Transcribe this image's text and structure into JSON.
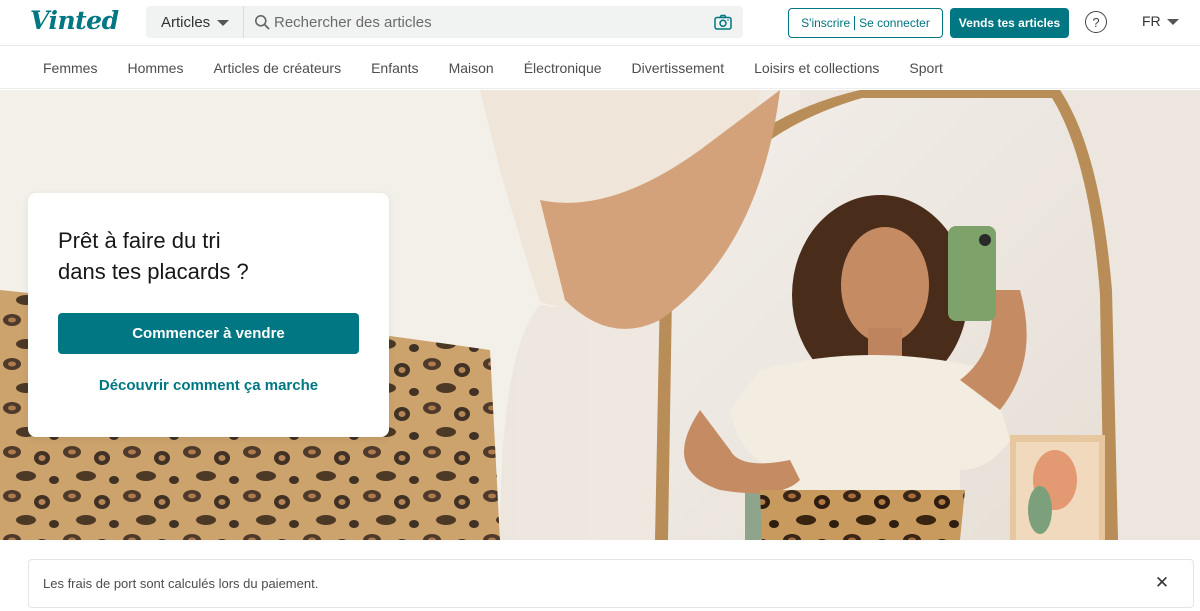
{
  "header": {
    "logo": "Vinted",
    "search": {
      "category_label": "Articles",
      "placeholder": "Rechercher des articles",
      "value": ""
    },
    "signup_label": "S'inscrire",
    "login_label": "Se connecter",
    "sell_label": "Vends tes articles",
    "help_symbol": "?",
    "language": "FR"
  },
  "catnav": {
    "items": [
      "Femmes",
      "Hommes",
      "Articles de créateurs",
      "Enfants",
      "Maison",
      "Électronique",
      "Divertissement",
      "Loisirs et collections",
      "Sport"
    ]
  },
  "hero": {
    "title_line1": "Prêt à faire du tri",
    "title_line2": "dans tes placards ?",
    "cta_label": "Commencer à vendre",
    "link_label": "Découvrir comment ça marche"
  },
  "notice": {
    "text": "Les frais de port sont calculés lors du paiement.",
    "close_symbol": "✕"
  },
  "colors": {
    "brand": "#007782",
    "text": "#171717"
  }
}
